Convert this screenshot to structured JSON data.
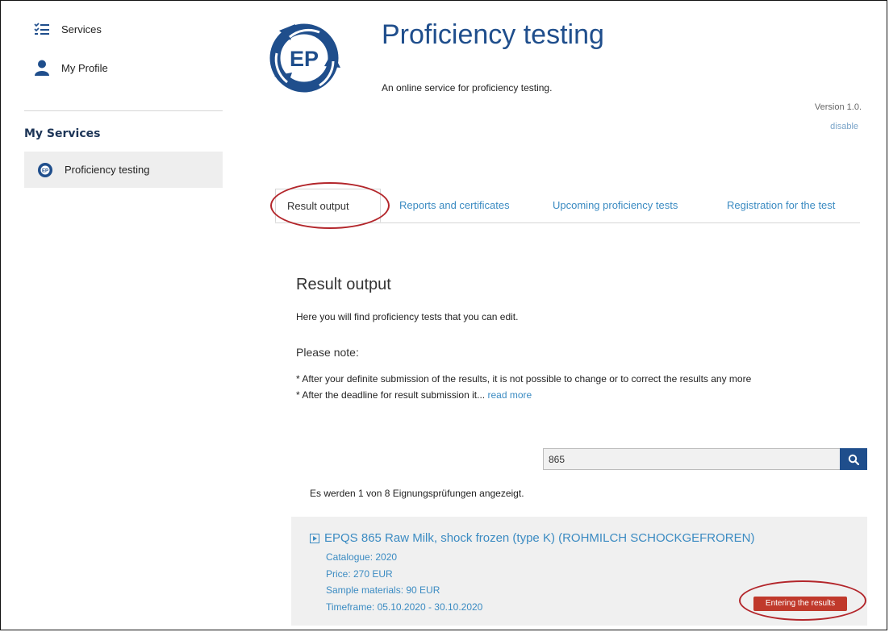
{
  "sidebar": {
    "items": [
      {
        "label": "Services",
        "icon": "services-checklist-icon"
      },
      {
        "label": "My Profile",
        "icon": "user-icon"
      }
    ],
    "section_title": "My Services",
    "services": [
      {
        "label": "Proficiency testing",
        "icon": "ep-logo-icon"
      }
    ]
  },
  "header": {
    "logo_text": "EP",
    "title": "Proficiency testing",
    "subtitle": "An online service for proficiency testing.",
    "version": "Version 1.0.",
    "disable_link": "disable"
  },
  "tabs": [
    {
      "label": "Result output",
      "active": true
    },
    {
      "label": "Reports and certificates",
      "active": false
    },
    {
      "label": "Upcoming proficiency tests",
      "active": false
    },
    {
      "label": "Registration for the test",
      "active": false
    }
  ],
  "content": {
    "title": "Result output",
    "intro": "Here you will find proficiency tests that you can edit.",
    "note_heading": "Please note:",
    "bullets": [
      "* After your definite submission of the results, it is not possible to change or to correct the results any more",
      "* After the deadline for result submission it..."
    ],
    "read_more": "read more"
  },
  "search": {
    "value": "865",
    "button_icon": "search-icon"
  },
  "results": {
    "count_text": "Es werden 1 von 8 Eignungsprüfungen angezeigt.",
    "items": [
      {
        "title": "EPQS 865 Raw Milk, shock frozen (type K) (ROHMILCH SCHOCKGEFROREN)",
        "catalogue": "Catalogue: 2020",
        "price": "Price: 270 EUR",
        "sample_materials": "Sample materials: 90 EUR",
        "timeframe": "Timeframe: 05.10.2020 - 30.10.2020",
        "status": "Entering the results"
      }
    ]
  },
  "colors": {
    "brand_blue": "#1f4e8c",
    "link_blue": "#3b8bc2",
    "status_red": "#c0392b",
    "annotation_red": "#b3262b"
  }
}
